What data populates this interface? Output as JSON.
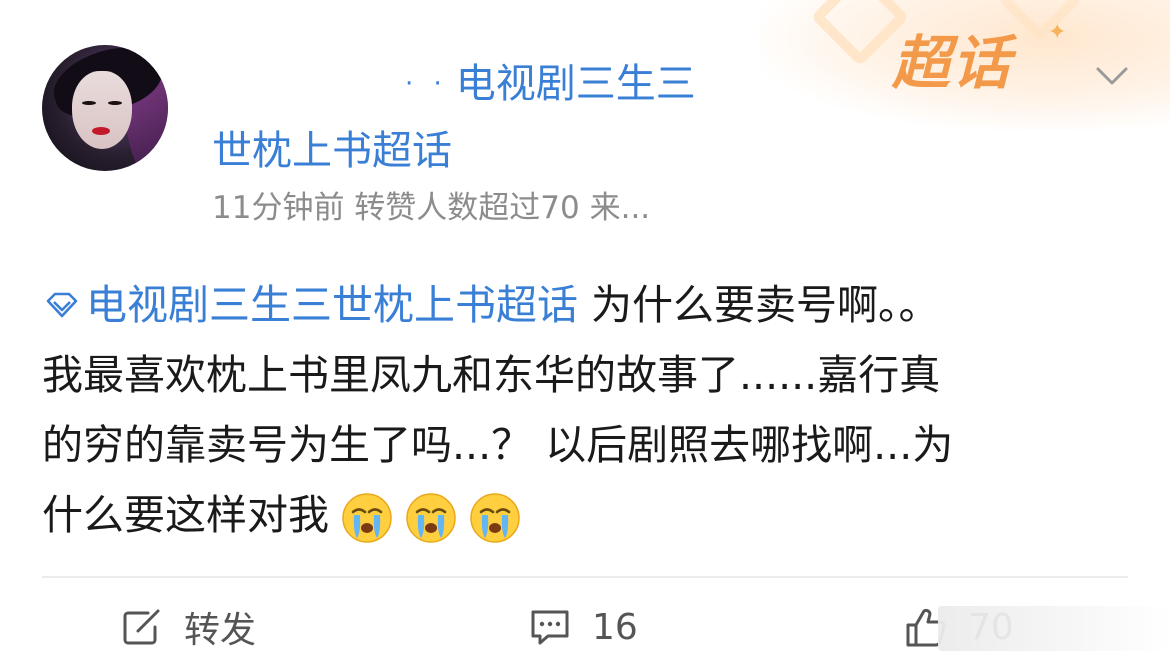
{
  "post": {
    "author_dots": "· ·",
    "author_line1": "电视剧三生三",
    "author_line2": "世枕上书超话",
    "meta": "11分钟前 转赞人数超过70  来...",
    "badge": "超话",
    "content": {
      "topic": "电视剧三生三世枕上书超话",
      "line1_rest": " 为什么要卖号啊。。",
      "line2": "我最喜欢枕上书里凤九和东华的故事了......嘉行真",
      "line3": "的穷的靠卖号为生了吗...？ 以后剧照去哪找啊...为",
      "line4": "什么要这样对我"
    },
    "emoji_count": 3,
    "emoji_name": "crying-face"
  },
  "actions": {
    "repost_label": "转发",
    "comment_count": "16",
    "like_count": "70"
  },
  "colors": {
    "link": "#3a7fd6",
    "meta": "#8c8c8c",
    "badge": "#f39a4a"
  }
}
